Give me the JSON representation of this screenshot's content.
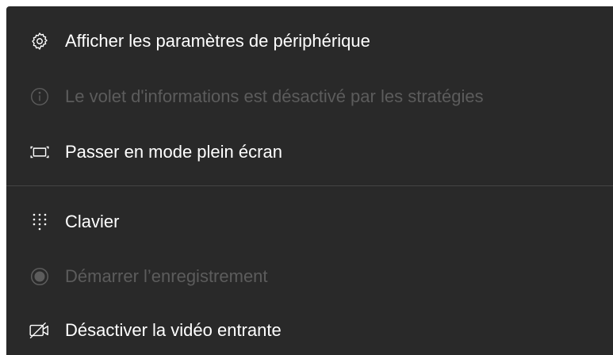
{
  "menu": {
    "items": [
      {
        "label": "Afficher les paramètres de périphérique",
        "icon": "gear-icon",
        "disabled": false
      },
      {
        "label": "Le volet d'informations est désactivé par les stratégies",
        "icon": "info-icon",
        "disabled": true
      },
      {
        "label": "Passer en mode plein écran",
        "icon": "fullscreen-icon",
        "disabled": false
      },
      {
        "label": "Clavier",
        "icon": "keypad-icon",
        "disabled": false
      },
      {
        "label": "Démarrer l’enregistrement",
        "icon": "record-icon",
        "disabled": true
      },
      {
        "label": "Désactiver la vidéo entrante",
        "icon": "video-off-icon",
        "disabled": false
      }
    ]
  },
  "colors": {
    "menu_background": "#292929",
    "text": "#ffffff",
    "text_disabled": "#5c5c5c",
    "divider": "#444444"
  }
}
